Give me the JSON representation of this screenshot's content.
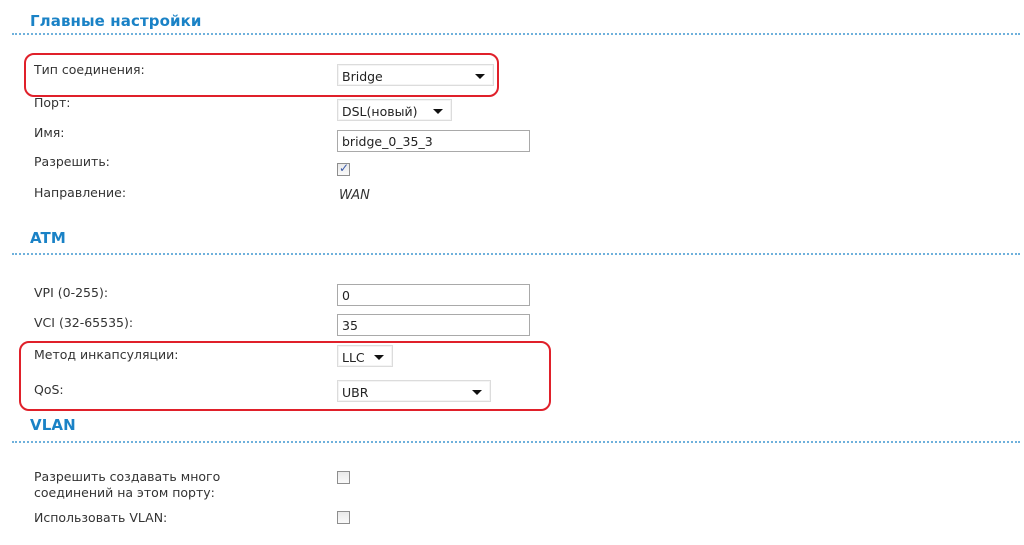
{
  "sections": {
    "main": {
      "title": "Главные настройки",
      "fields": {
        "connection_type": {
          "label": "Тип соединения:",
          "value": "Bridge"
        },
        "port": {
          "label": "Порт:",
          "value": "DSL(новый)"
        },
        "name": {
          "label": "Имя:",
          "value": "bridge_0_35_3"
        },
        "enable": {
          "label": "Разрешить:",
          "checked": true
        },
        "direction": {
          "label": "Направление:",
          "value": "WAN"
        }
      }
    },
    "atm": {
      "title": "ATM",
      "fields": {
        "vpi": {
          "label": "VPI (0-255):",
          "value": "0"
        },
        "vci": {
          "label": "VCI (32-65535):",
          "value": "35"
        },
        "encapsulation": {
          "label": "Метод инкапсуляции:",
          "value": "LLC"
        },
        "qos": {
          "label": "QoS:",
          "value": "UBR"
        }
      }
    },
    "vlan": {
      "title": "VLAN",
      "fields": {
        "multi_conn": {
          "label_line1": "Разрешить создавать много",
          "label_line2": "соединений на этом порту:",
          "checked": false
        },
        "use_vlan": {
          "label": "Использовать VLAN:",
          "checked": false
        }
      }
    }
  },
  "colors": {
    "heading": "#1a82c6",
    "highlight": "#e0202a",
    "dots": "#6fb1dc"
  }
}
